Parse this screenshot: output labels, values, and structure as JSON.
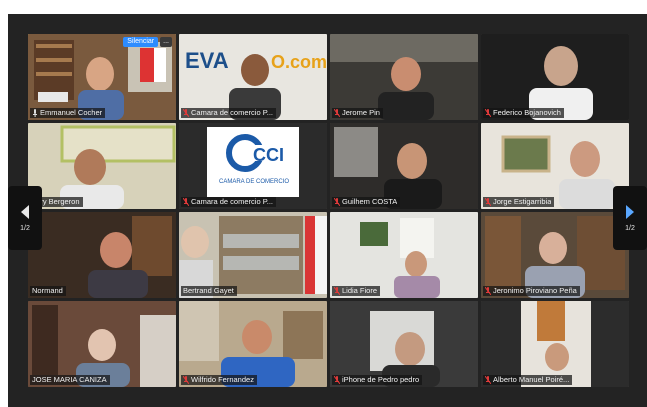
{
  "meeting": {
    "participants": [
      {
        "name": "Emmanuel Cocher",
        "muted": false,
        "active": true
      },
      {
        "name": "Camara de comercio P...",
        "muted": true,
        "active": false
      },
      {
        "name": "Jerome Pin",
        "muted": true,
        "active": false
      },
      {
        "name": "Federico Bojanovich",
        "muted": true,
        "active": false
      },
      {
        "name": "enry Bergeron",
        "muted": false,
        "active": false
      },
      {
        "name": "Camara de comercio P...",
        "muted": true,
        "active": false
      },
      {
        "name": "Guilhem COSTA",
        "muted": true,
        "active": false
      },
      {
        "name": "Jorge Estigarribia",
        "muted": true,
        "active": false
      },
      {
        "name": "Normand",
        "muted": false,
        "active": false
      },
      {
        "name": "Bertrand Gayet",
        "muted": false,
        "active": false
      },
      {
        "name": "Lidia Fiore",
        "muted": true,
        "active": false
      },
      {
        "name": "Jeronimo Piroviano Peña",
        "muted": true,
        "active": false
      },
      {
        "name": "JOSE MARIA CANIZA",
        "muted": false,
        "active": false
      },
      {
        "name": "Wilfrido Fernandez",
        "muted": true,
        "active": false
      },
      {
        "name": "iPhone de Pedro pedro",
        "muted": true,
        "active": false
      },
      {
        "name": "Alberto Manuel Poiré...",
        "muted": true,
        "active": false
      }
    ],
    "active_tile_controls": {
      "silence_label": "Silenciar",
      "more_label": "..."
    },
    "pager": {
      "left_page": "1/2",
      "right_page": "1/2"
    },
    "logos": {
      "banner_text": "EVA",
      "banner_suffix": "O.com",
      "cci_text": "CCI",
      "cci_caption": "CAMARA DE COMERCIO"
    }
  },
  "colors": {
    "accent": "#2d8cff",
    "active_border": "#d8d36a",
    "muted_icon": "#e03a3a",
    "background": "#232323"
  }
}
